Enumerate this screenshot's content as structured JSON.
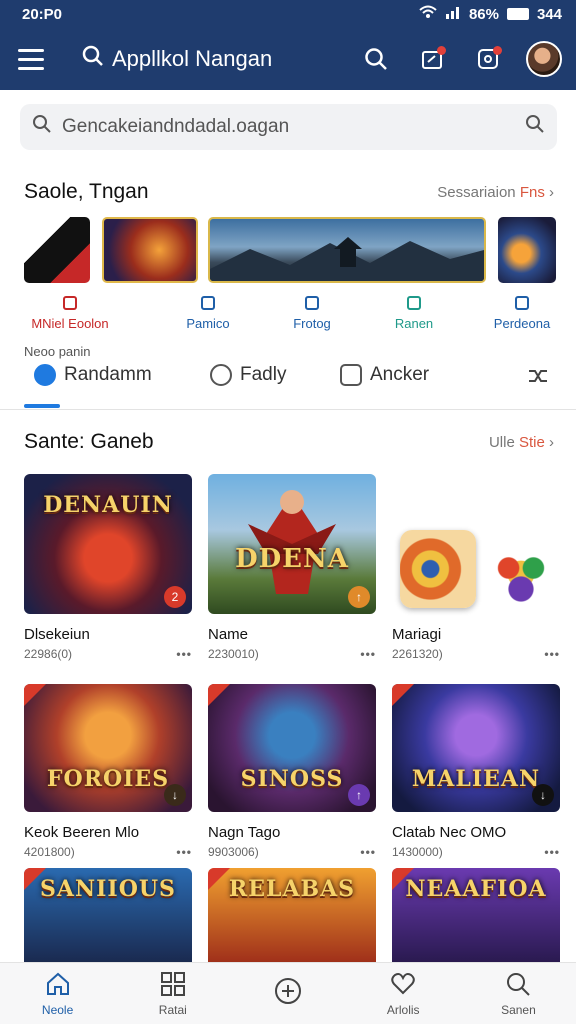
{
  "status": {
    "time": "20:P0",
    "battery": "86%",
    "extra": "344"
  },
  "appbar": {
    "title": "Appllkol Nangan",
    "icons": [
      "menu-icon",
      "search-icon",
      "share-icon",
      "notification-icon",
      "avatar"
    ]
  },
  "search": {
    "placeholder": "Gencakeiandndadal.oagan"
  },
  "section1": {
    "title": "Saole, Tngan",
    "more": "Sessariaion",
    "more_accent": "Fns"
  },
  "categories": [
    {
      "label": "MNiel Eoolon"
    },
    {
      "label": "Pamico"
    },
    {
      "label": "Frotog"
    },
    {
      "label": "Ranen"
    },
    {
      "label": "Perdeona"
    }
  ],
  "filter_label": "Neoo panin",
  "tabs": [
    {
      "label": "Randamm"
    },
    {
      "label": "Fadly"
    },
    {
      "label": "Ancker"
    }
  ],
  "section2": {
    "title": "Sante: Ganeb",
    "more": "Ulle",
    "more_accent": "Stie"
  },
  "games": [
    {
      "name": "Dlsekeiun",
      "meta": "22986(0)",
      "art": "DENAUIN",
      "badge": "2"
    },
    {
      "name": "Name",
      "meta": "2230010)",
      "art": "DDENA",
      "badge": "↑"
    },
    {
      "name": "Mariagi",
      "meta": "2261320)",
      "art": "",
      "badge": ""
    },
    {
      "name": "Keok Beeren Mlo",
      "meta": "4201800)",
      "art": "FOROIES",
      "badge": "↓"
    },
    {
      "name": "Nagn Tago",
      "meta": "9903006)",
      "art": "SINOSS",
      "badge": "↑"
    },
    {
      "name": "Clatab Nec OMO",
      "meta": "1430000)",
      "art": "MALIEAN",
      "badge": "↓"
    },
    {
      "name": "",
      "meta": "",
      "art": "SANIIOUS",
      "badge": ""
    },
    {
      "name": "",
      "meta": "",
      "art": "RELABAS",
      "badge": ""
    },
    {
      "name": "",
      "meta": "",
      "art": "NEAAFIOA",
      "badge": ""
    }
  ],
  "bottom_nav": [
    {
      "label": "Neole",
      "icon": "home-icon"
    },
    {
      "label": "Ratai",
      "icon": "grid-icon"
    },
    {
      "label": "",
      "icon": "add-icon"
    },
    {
      "label": "Arlolis",
      "icon": "heart-icon"
    },
    {
      "label": "Sanen",
      "icon": "search-icon"
    }
  ]
}
